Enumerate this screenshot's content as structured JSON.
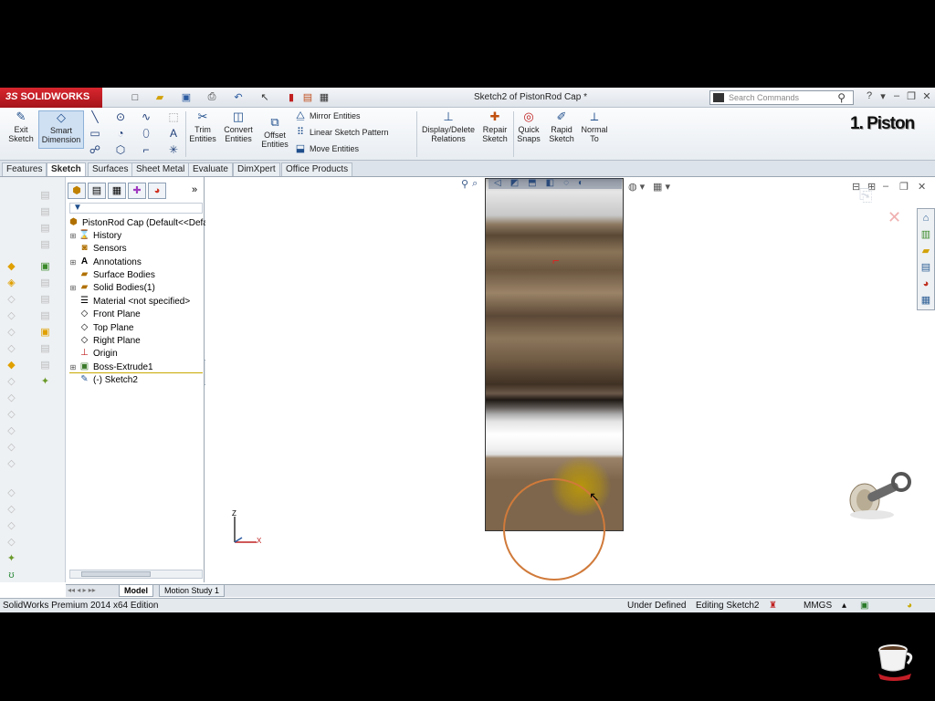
{
  "window": {
    "logo_brand": "SOLIDWORKS",
    "logo_ds": "3S",
    "document_title": "Sketch2 of PistonRod Cap *",
    "search_placeholder": "Search Commands"
  },
  "command_manager": {
    "exit_sketch": "Exit Sketch",
    "smart_dimension": "Smart Dimension",
    "trim_entities": "Trim Entities",
    "convert_entities": "Convert Entities",
    "offset_entities": "Offset Entities",
    "mirror_entities": "Mirror Entities",
    "linear_sketch_pattern": "Linear Sketch Pattern",
    "move_entities": "Move Entities",
    "display_delete_relations": "Display/Delete Relations",
    "repair_sketch": "Repair Sketch",
    "quick_snaps": "Quick Snaps",
    "rapid_sketch": "Rapid Sketch",
    "normal_to": "Normal To",
    "brand_overlay": "1. Piston"
  },
  "tabs": [
    "Features",
    "Sketch",
    "Surfaces",
    "Sheet Metal",
    "Evaluate",
    "DimXpert",
    "Office Products"
  ],
  "active_tab": "Sketch",
  "feature_tree": {
    "root": "PistonRod Cap  (Default<<Defa",
    "items": [
      {
        "label": "History",
        "icon": "history-icon"
      },
      {
        "label": "Sensors",
        "icon": "sensors-icon"
      },
      {
        "label": "Annotations",
        "icon": "annotations-icon"
      },
      {
        "label": "Surface Bodies",
        "icon": "surface-bodies-icon"
      },
      {
        "label": "Solid Bodies(1)",
        "icon": "solid-bodies-icon"
      },
      {
        "label": "Material <not specified>",
        "icon": "material-icon"
      },
      {
        "label": "Front Plane",
        "icon": "plane-icon"
      },
      {
        "label": "Top Plane",
        "icon": "plane-icon"
      },
      {
        "label": "Right Plane",
        "icon": "plane-icon"
      },
      {
        "label": "Origin",
        "icon": "origin-icon"
      },
      {
        "label": "Boss-Extrude1",
        "icon": "extrude-icon"
      },
      {
        "label": "(-) Sketch2",
        "icon": "sketch-icon"
      }
    ]
  },
  "bottom_tabs": [
    "Model",
    "Motion Study 1"
  ],
  "status_bar": {
    "edition": "SolidWorks Premium 2014 x64 Edition",
    "state": "Under Defined",
    "editing": "Editing Sketch2",
    "units": "MMGS"
  },
  "triad": {
    "z": "Z",
    "x": "X"
  },
  "colors": {
    "brand_red": "#c41e27",
    "sketch_circle": "#d07a3a",
    "selection_glow": "#b8960c",
    "origin_marker": "#e02020"
  }
}
